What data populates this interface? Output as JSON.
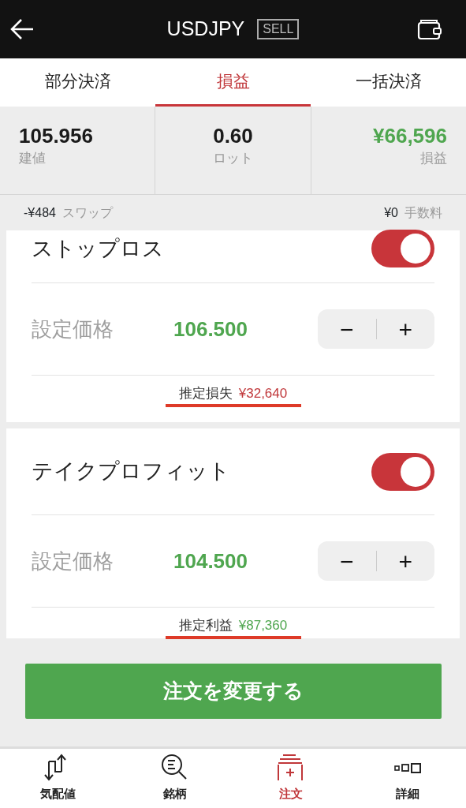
{
  "header": {
    "title": "USDJPY",
    "side_badge": "SELL"
  },
  "tabs": [
    {
      "label": "部分決済",
      "selected": false
    },
    {
      "label": "損益",
      "selected": true
    },
    {
      "label": "一括決済",
      "selected": false
    }
  ],
  "stats": [
    {
      "value": "105.956",
      "label": "建値",
      "kind": "plain"
    },
    {
      "value": "0.60",
      "label": "ロット",
      "kind": "plain"
    },
    {
      "value": "¥66,596",
      "label": "損益",
      "kind": "profit"
    }
  ],
  "swap": {
    "value": "-¥484",
    "label": "スワップ"
  },
  "fee": {
    "value": "¥0",
    "label": "手数料"
  },
  "orders": [
    {
      "title": "ストップロス",
      "on": true,
      "price_label": "設定価格",
      "price": "106.500",
      "minus": "−",
      "plus": "+",
      "estimate_label": "推定損失",
      "estimate": "¥32,640",
      "kind": "loss"
    },
    {
      "title": "テイクプロフィット",
      "on": true,
      "price_label": "設定価格",
      "price": "104.500",
      "minus": "−",
      "plus": "+",
      "estimate_label": "推定利益",
      "estimate": "¥87,360",
      "kind": "profit"
    }
  ],
  "submit": "注文を変更する",
  "nav": [
    {
      "label": "気配値",
      "kind": "quotes",
      "selected": false
    },
    {
      "label": "銘柄",
      "kind": "symbols",
      "selected": false
    },
    {
      "label": "注文",
      "kind": "order",
      "selected": true
    },
    {
      "label": "詳細",
      "kind": "details",
      "selected": false
    }
  ]
}
